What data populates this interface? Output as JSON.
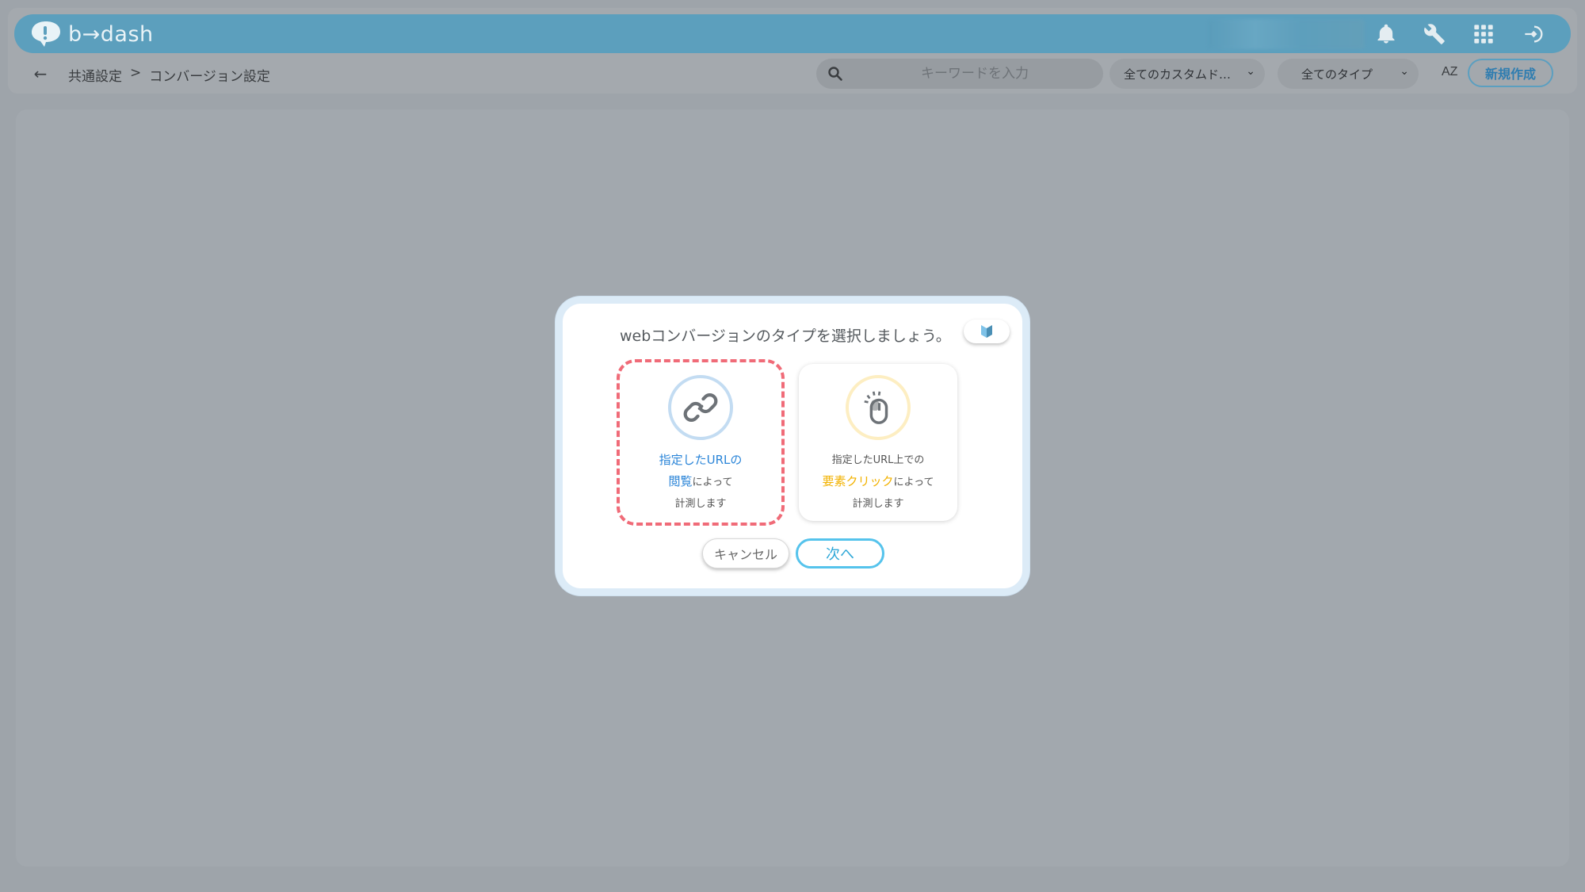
{
  "app": {
    "logo_text": "b→dash"
  },
  "header": {
    "icons": [
      "bell-icon",
      "wrench-icon",
      "grid-icon",
      "sign-in-icon"
    ]
  },
  "subbar": {
    "breadcrumb": [
      "共通設定",
      ">",
      "コンバージョン設定"
    ],
    "search_placeholder": "キーワードを入力",
    "filter_custom": "全てのカスタムド…",
    "filter_type": "全てのタイプ",
    "sort_label": "AZ",
    "new_button": "新規作成"
  },
  "modal": {
    "title": "webコンバージョンのタイプを選択しましょう。",
    "cards": [
      {
        "id": "url-view",
        "selected": true,
        "icon": "link-icon",
        "line1": "指定したURLの",
        "line2_highlight": "閲覧",
        "line2_rest": "によって",
        "line3": "計測します"
      },
      {
        "id": "element-click",
        "selected": false,
        "icon": "mouse-click-icon",
        "line1": "指定したURL上での",
        "line2_highlight": "要素クリック",
        "line2_rest": "によって",
        "line3": "計測します"
      }
    ],
    "cancel_label": "キャンセル",
    "next_label": "次へ"
  },
  "colors": {
    "header": "#5c9fbd",
    "selected_dash": "#f06b78",
    "highlight_blue": "#2b85d8",
    "highlight_orange": "#f2b200",
    "next_border": "#55c3ec"
  }
}
